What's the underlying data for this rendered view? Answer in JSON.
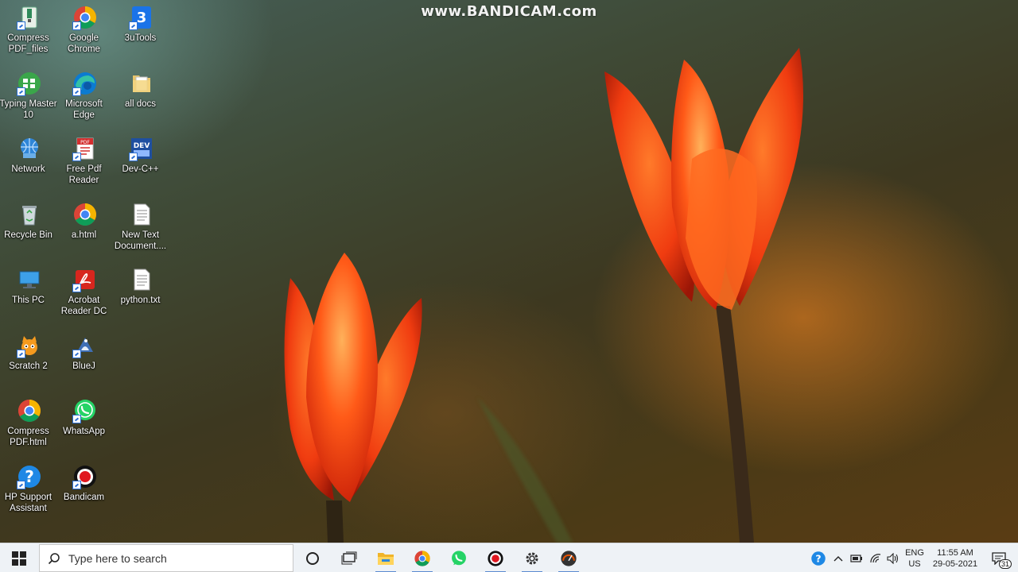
{
  "watermark": "www.BANDICAM.com",
  "desktop_icons": [
    {
      "label": "Compress PDF_files",
      "icon": "folder-zip-icon"
    },
    {
      "label": "Google Chrome",
      "icon": "chrome-icon"
    },
    {
      "label": "3uTools",
      "icon": "3utools-icon"
    },
    {
      "label": "Typing Master 10",
      "icon": "typing-master-icon"
    },
    {
      "label": "Microsoft Edge",
      "icon": "edge-icon"
    },
    {
      "label": "all docs",
      "icon": "folder-icon"
    },
    {
      "label": "Network",
      "icon": "network-icon"
    },
    {
      "label": "Free Pdf Reader",
      "icon": "pdf-reader-icon"
    },
    {
      "label": "Dev-C++",
      "icon": "devcpp-icon"
    },
    {
      "label": "Recycle Bin",
      "icon": "recycle-bin-icon"
    },
    {
      "label": "a.html",
      "icon": "chrome-icon"
    },
    {
      "label": "New Text Document....",
      "icon": "text-file-icon"
    },
    {
      "label": "This PC",
      "icon": "this-pc-icon"
    },
    {
      "label": "Acrobat Reader DC",
      "icon": "acrobat-icon"
    },
    {
      "label": "python.txt",
      "icon": "text-file-icon"
    },
    {
      "label": "Scratch 2",
      "icon": "scratch-icon"
    },
    {
      "label": "BlueJ",
      "icon": "bluej-icon"
    },
    {
      "label": "Compress PDF.html",
      "icon": "chrome-icon"
    },
    {
      "label": "WhatsApp",
      "icon": "whatsapp-icon"
    },
    {
      "label": "HP Support Assistant",
      "icon": "hp-support-icon"
    },
    {
      "label": "Bandicam",
      "icon": "bandicam-icon"
    }
  ],
  "taskbar": {
    "search_placeholder": "Type here to search",
    "pinned": [
      "cortana-icon",
      "task-view-icon",
      "file-explorer-icon",
      "chrome-icon",
      "whatsapp-icon",
      "bandicam-icon",
      "settings-icon",
      "speedometer-icon"
    ],
    "tray": {
      "language_top": "ENG",
      "language_bottom": "US",
      "time": "11:55 AM",
      "date": "29-05-2021",
      "notification_count": "31"
    }
  },
  "colors": {
    "taskbar_bg": "#eef2f6",
    "accent": "#5b8bd1",
    "flower": "#ff4a14"
  }
}
